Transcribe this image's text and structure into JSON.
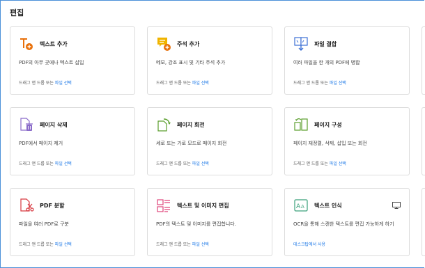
{
  "section": {
    "title": "편집"
  },
  "cards": [
    {
      "title": "텍스트 추가",
      "desc": "PDF의 아무 곳에나 텍스트 삽입",
      "foot_prefix": "드래그 앤 드롭 또는 ",
      "foot_link": "파일 선택",
      "icon": "add-text-icon"
    },
    {
      "title": "주석 추가",
      "desc": "메모, 강조 표시 및 기타 주석 추가",
      "foot_prefix": "드래그 앤 드롭 또는 ",
      "foot_link": "파일 선택",
      "icon": "add-comment-icon"
    },
    {
      "title": "파일 결합",
      "desc": "여러 파일을 한 개의 PDF에 병합",
      "foot_prefix": "드래그 앤 드롭 또는 ",
      "foot_link": "파일 선택",
      "icon": "combine-files-icon"
    },
    {
      "title": "페이지 삭제",
      "desc": "PDF에서 페이지 제거",
      "foot_prefix": "드래그 앤 드롭 또는 ",
      "foot_link": "파일 선택",
      "icon": "delete-pages-icon"
    },
    {
      "title": "페이지 회전",
      "desc": "세로 또는 가로 모드로 페이지 회전",
      "foot_prefix": "드래그 앤 드롭 또는 ",
      "foot_link": "파일 선택",
      "icon": "rotate-pages-icon"
    },
    {
      "title": "페이지 구성",
      "desc": "페이지 재정렬, 삭제, 삽입 또는 회전",
      "foot_prefix": "드래그 앤 드롭 또는 ",
      "foot_link": "파일 선택",
      "icon": "organize-pages-icon"
    },
    {
      "title": "PDF 분할",
      "desc": "파일을 여러 PDF로 구분",
      "foot_prefix": "드래그 앤 드롭 또는 ",
      "foot_link": "파일 선택",
      "icon": "split-pdf-icon"
    },
    {
      "title": "텍스트 및 이미지 편집",
      "desc": "PDF의 텍스트 및 이미지를 편집합니다.",
      "foot_prefix": "드래그 앤 드롭 또는 ",
      "foot_link": "파일 선택",
      "icon": "edit-text-image-icon"
    },
    {
      "title": "텍스트 인식",
      "desc": "OCR을 통해 스캔한 텍스트를 편집 가능하게 하기",
      "foot_prefix": "",
      "foot_link": "데스크탑에서 사용",
      "icon": "recognize-text-icon",
      "extra_icon": "desktop-icon"
    }
  ],
  "colors": {
    "accent": "#1473e6",
    "orange": "#e8700a",
    "yellow": "#f0b400",
    "blue": "#3b6fd4",
    "purple": "#8a6bc9",
    "green": "#5a9e2c",
    "red": "#d7373f",
    "pink": "#e0457b",
    "teal": "#3aa07a"
  }
}
